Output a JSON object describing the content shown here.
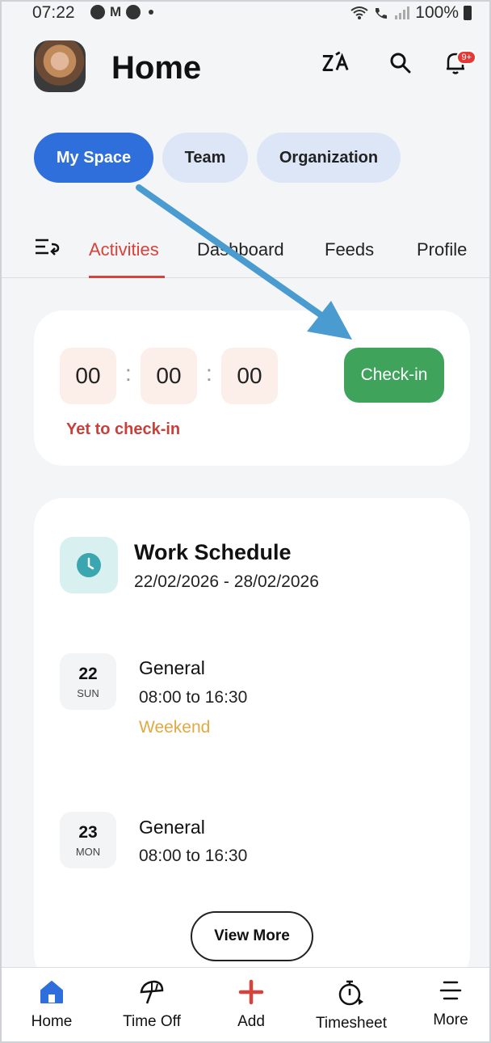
{
  "status_bar": {
    "time": "07:22",
    "battery": "100%"
  },
  "header": {
    "title": "Home",
    "notification_badge": "9+"
  },
  "segments": [
    {
      "label": "My Space",
      "active": true
    },
    {
      "label": "Team",
      "active": false
    },
    {
      "label": "Organization",
      "active": false
    }
  ],
  "tabs": [
    {
      "label": "Activities",
      "active": true
    },
    {
      "label": "Dashboard",
      "active": false
    },
    {
      "label": "Feeds",
      "active": false
    },
    {
      "label": "Profile",
      "active": false
    }
  ],
  "checkin": {
    "hours": "00",
    "minutes": "00",
    "seconds": "00",
    "button_label": "Check-in",
    "status": "Yet to check-in"
  },
  "schedule": {
    "title": "Work Schedule",
    "range": "22/02/2026 - 28/02/2026",
    "days": [
      {
        "day_num": "22",
        "day_name": "SUN",
        "shift": "General",
        "time": "08:00 to 16:30",
        "note": "Weekend"
      },
      {
        "day_num": "23",
        "day_name": "MON",
        "shift": "General",
        "time": "08:00 to 16:30",
        "note": ""
      }
    ],
    "view_more": "View More"
  },
  "bottom_nav": [
    {
      "label": "Home",
      "icon": "home-icon",
      "active": true
    },
    {
      "label": "Time Off",
      "icon": "umbrella-icon",
      "active": false
    },
    {
      "label": "Add",
      "icon": "plus-icon",
      "active": false
    },
    {
      "label": "Timesheet",
      "icon": "stopwatch-icon",
      "active": false
    },
    {
      "label": "More",
      "icon": "menu-icon",
      "active": false
    }
  ],
  "colors": {
    "primary": "#2f6fdb",
    "accent_red": "#d9413b",
    "checkin_green": "#3fa35c",
    "weekend_orange": "#e2a843",
    "annotation_arrow": "#4a9cd0"
  }
}
